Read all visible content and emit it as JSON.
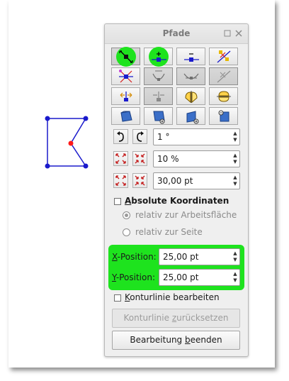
{
  "dialog": {
    "title": "Pfade",
    "title_icons": [
      "restore-icon",
      "close-icon"
    ]
  },
  "toolbar_rows": [
    [
      "move-points-icon",
      "insert-point-icon",
      "delete-point-icon",
      "split-curve-icon"
    ],
    [
      "convert-to-curve-icon",
      "corner-point-icon",
      "symmetric-point-icon",
      "smooth-point-icon"
    ],
    [
      "flip-horizontal-icon",
      "flip-vertical-icon",
      "shear-icon",
      "reset-contour-icon"
    ],
    [
      "rotate-left-icon",
      "move-down-icon",
      "enlarge-icon",
      "shrink-icon"
    ]
  ],
  "rotate": {
    "value": "1 °"
  },
  "scale_percent": {
    "value": "10 %"
  },
  "scale_points": {
    "value": "30,00 pt"
  },
  "absolute": {
    "label_u": "A",
    "label_rest": "bsolute Koordinaten",
    "checked": false
  },
  "relative_page_area": "relativ zur Arbeitsfläche",
  "relative_page": "relativ zur Seite",
  "position": {
    "x_label_u": "X",
    "x_label_rest": "-Position:",
    "x_value": "25,00 pt",
    "y_label_u": "Y",
    "y_label_rest": "-Position:",
    "y_value": "25,00 pt"
  },
  "contour": {
    "label_u": "K",
    "label_rest": "onturlinie bearbeiten",
    "checked": false
  },
  "reset_contour_button": {
    "pre": "Konturlinie ",
    "u": "z",
    "post": "urücksetzen"
  },
  "end_edit_button": {
    "pre": "Bearbeitung ",
    "u": "b",
    "post": "eenden"
  },
  "colors": {
    "highlight": "#1ee31e",
    "path_line": "#1a1acc",
    "selected_point": "#ff1a1a"
  }
}
